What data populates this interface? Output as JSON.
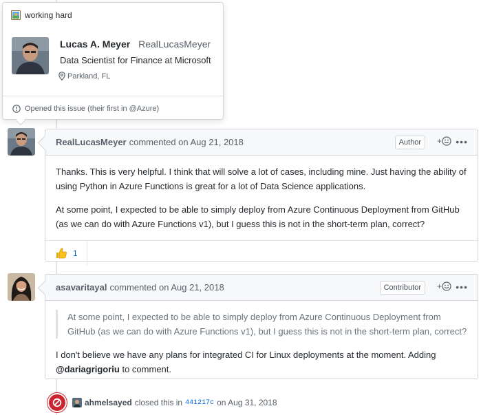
{
  "hovercard": {
    "status_text": "working hard",
    "name": "Lucas A. Meyer",
    "login": "RealLucasMeyer",
    "bio": "Data Scientist for Finance at Microsoft",
    "location": "Parkland, FL",
    "footer_text": "Opened this issue (their first in @Azure)"
  },
  "comments": [
    {
      "author": "RealLucasMeyer",
      "meta": "commented on Aug 21, 2018",
      "role": "Author",
      "body": [
        "Thanks. This is very helpful. I think that will solve a lot of cases, including mine. Just having the ability of using Python in Azure Functions is great for a lot of Data Science applications.",
        "At some point, I expected to be able to simply deploy from Azure Continuous Deployment from GitHub (as we can do with Azure Functions v1), but I guess this is not in the short-term plan, correct?"
      ],
      "reaction_count": "1",
      "reaction_icon": "thumbs-up"
    },
    {
      "author": "asavaritayal",
      "meta": "commented on Aug 21, 2018",
      "role": "Contributor",
      "quote": "At some point, I expected to be able to simply deploy from Azure Continuous Deployment from GitHub (as we can do with Azure Functions v1), but I guess this is not in the short-term plan, correct?",
      "body_text": "I don't believe we have any plans for integrated CI for Linux deployments at the moment. Adding",
      "mention": "@dariagrigoriu",
      "body_suffix": " to comment."
    }
  ],
  "event": {
    "actor": "ahmelsayed",
    "action": "closed this in",
    "commit": "441217c",
    "date": "on Aug 31, 2018"
  },
  "react_plus": "+",
  "more_dots": "•••",
  "colors": {
    "closed": "#cb2431",
    "link": "#0366d6",
    "header_bg": "#f6f8fa",
    "border": "#d1d5da"
  }
}
